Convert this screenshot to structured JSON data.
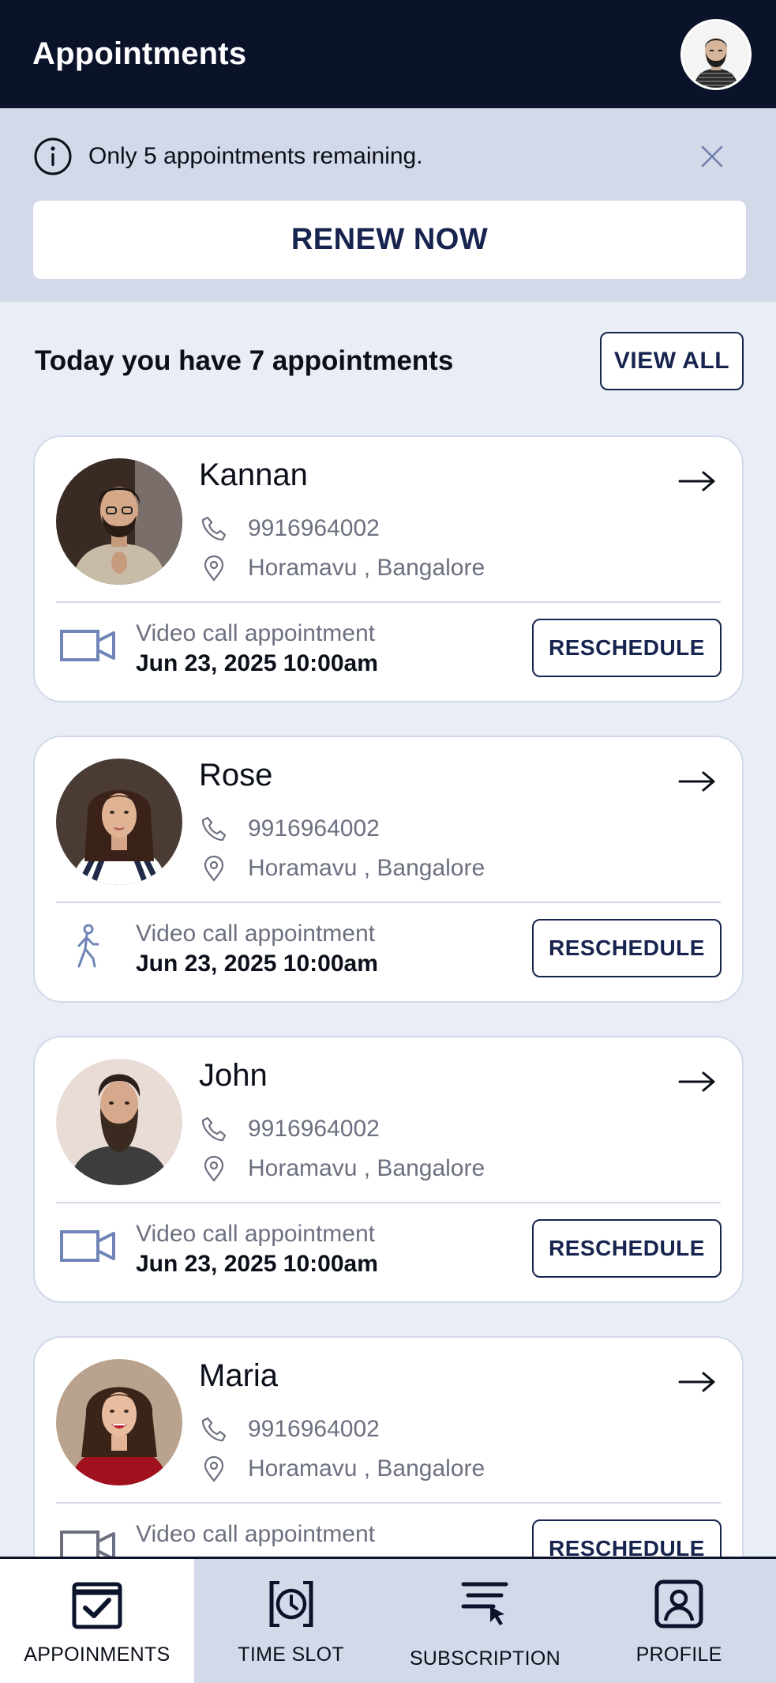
{
  "header": {
    "title": "Appointments"
  },
  "notice": {
    "text": "Only 5 appointments remaining.",
    "renew_label": "RENEW NOW"
  },
  "summary": {
    "title": "Today you have 7 appointments",
    "view_all_label": "VIEW ALL"
  },
  "appointments": [
    {
      "name": "Kannan",
      "phone": "9916964002",
      "location": "Horamavu , Bangalore",
      "type_label": "Video call appointment",
      "datetime": "Jun 23, 2025 10:00am",
      "type_icon": "video-camera-icon",
      "button": "RESCHEDULE"
    },
    {
      "name": "Rose",
      "phone": "9916964002",
      "location": "Horamavu , Bangalore",
      "type_label": "Video call appointment",
      "datetime": "Jun 23, 2025 10:00am",
      "type_icon": "walking-person-icon",
      "button": "RESCHEDULE"
    },
    {
      "name": "John",
      "phone": "9916964002",
      "location": "Horamavu , Bangalore",
      "type_label": "Video call appointment",
      "datetime": "Jun 23, 2025 10:00am",
      "type_icon": "video-camera-icon",
      "button": "RESCHEDULE"
    },
    {
      "name": "Maria",
      "phone": "9916964002",
      "location": "Horamavu , Bangalore",
      "type_label": "Video call appointment",
      "datetime": "",
      "type_icon": "video-camera-icon",
      "button": "RESCHEDULE"
    }
  ],
  "nav": [
    {
      "label": "APPOINMENTS",
      "icon": "calendar-check-icon",
      "active": true
    },
    {
      "label": "TIME SLOT",
      "icon": "clock-icon",
      "active": false
    },
    {
      "label": "SUBSCRIPTION",
      "icon": "subscription-icon",
      "active": false
    },
    {
      "label": "PROFILE",
      "icon": "profile-icon",
      "active": false
    }
  ],
  "colors": {
    "navy": "#0b132b",
    "accent": "#17244f",
    "panel": "#d3d9e9",
    "background": "#e9edf6",
    "icon_blue": "#7084b8"
  }
}
